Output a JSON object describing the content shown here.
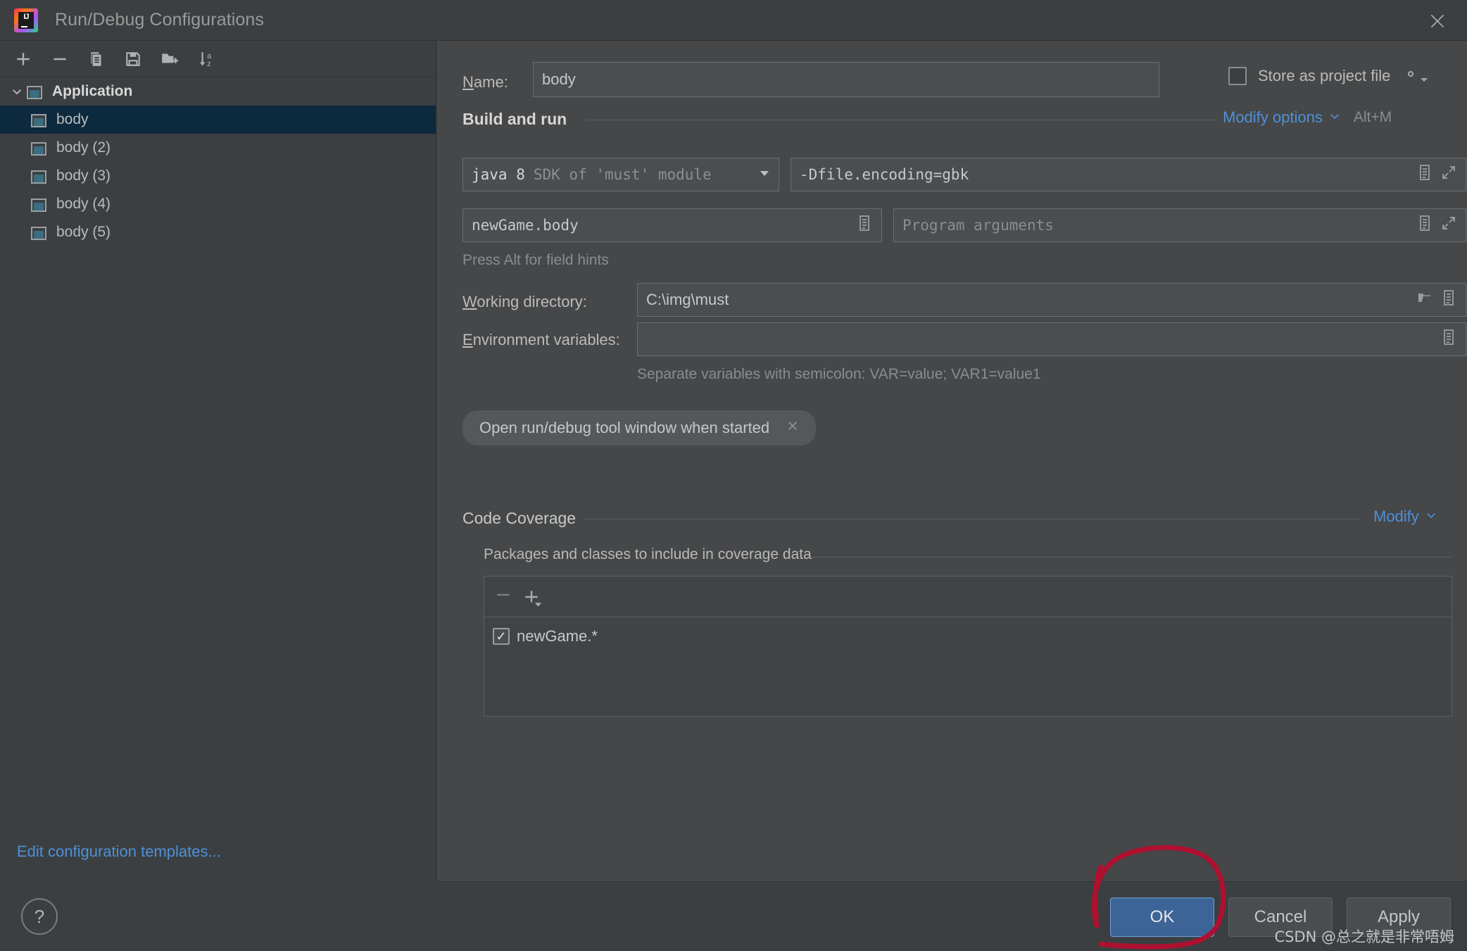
{
  "window": {
    "title": "Run/Debug Configurations",
    "logo_text": "IJ",
    "close_icon": "close-icon"
  },
  "left_panel": {
    "toolbar": [
      {
        "name": "add-configuration-button",
        "icon": "plus-icon",
        "tooltip": "Add New Configuration"
      },
      {
        "name": "remove-configuration-button",
        "icon": "minus-icon",
        "tooltip": "Remove Configuration"
      },
      {
        "name": "copy-configuration-button",
        "icon": "copy-icon",
        "tooltip": "Copy Configuration"
      },
      {
        "name": "save-configuration-button",
        "icon": "save-icon",
        "tooltip": "Save Configuration"
      },
      {
        "name": "move-into-folder-button",
        "icon": "new-folder-icon",
        "tooltip": "Move into new folder"
      },
      {
        "name": "sort-configurations-button",
        "icon": "sort-alphabetically-icon",
        "tooltip": "Sort Configurations"
      }
    ],
    "tree": {
      "group_label": "Application",
      "group_icon": "application-config-icon",
      "chevron_icon": "chevron-down-icon",
      "items": [
        {
          "label": "body",
          "icon": "application-config-icon",
          "selected": true
        },
        {
          "label": "body (2)",
          "icon": "application-config-icon",
          "selected": false
        },
        {
          "label": "body (3)",
          "icon": "application-config-icon",
          "selected": false
        },
        {
          "label": "body (4)",
          "icon": "application-config-icon",
          "selected": false
        },
        {
          "label": "body (5)",
          "icon": "application-config-icon",
          "selected": false
        }
      ]
    },
    "edit_templates_link": "Edit configuration templates..."
  },
  "form": {
    "name_label": "Name:",
    "name_label_mnemonic": "N",
    "name_label_rest": "ame:",
    "name_value": "body",
    "store_as_project_file_label": "Store as project file",
    "store_as_project_file_checked": false,
    "gear_icon": "gear-icon",
    "build_and_run_title": "Build and run",
    "modify_options_link": "Modify options",
    "modify_options_shortcut": "Alt+M",
    "modify_options_caret": "chevron-down-icon",
    "jre_combo_value": "java 8",
    "jre_combo_hint": "SDK of 'must' module",
    "vm_options_value": "-Dfile.encoding=gbk",
    "main_class_value": "newGame.body",
    "program_arguments_placeholder": "Program arguments",
    "field_hint": "Press Alt for field hints",
    "working_directory_label": "Working directory:",
    "working_directory_mnemonic": "W",
    "working_directory_rest": "orking directory:",
    "working_directory_value": "C:\\img\\must",
    "environment_variables_label": "Environment variables:",
    "environment_variables_mnemonic": "E",
    "environment_variables_rest": "nvironment variables:",
    "environment_variables_value": "",
    "environment_variables_hint": "Separate variables with semicolon: VAR=value; VAR1=value1",
    "option_chip_label": "Open run/debug tool window when started",
    "option_chip_close_icon": "close-icon"
  },
  "code_coverage": {
    "title": "Code Coverage",
    "modify_link": "Modify",
    "modify_caret": "chevron-down-icon",
    "packages_title": "Packages and classes to include in coverage data",
    "toolbar": [
      {
        "name": "coverage-remove-button",
        "icon": "minus-icon"
      },
      {
        "name": "coverage-add-button",
        "icon": "plus-dropdown-icon"
      }
    ],
    "items": [
      {
        "label": "newGame.*",
        "checked": true
      }
    ]
  },
  "bottom_bar": {
    "help_icon": "question-mark-icon",
    "ok_label": "OK",
    "cancel_label": "Cancel",
    "apply_label": "Apply"
  },
  "annotation": {
    "type": "hand-drawn-circle",
    "color": "#b01030",
    "target": "OK"
  },
  "watermark": "CSDN @总之就是非常唔姆",
  "colors": {
    "window_bg": "#3c3f41",
    "panel_bg": "#454749",
    "selection_bg": "#0d293e",
    "accent_link": "#4e90d8",
    "ok_button": "#3c6497",
    "annotation_red": "#b01030"
  }
}
